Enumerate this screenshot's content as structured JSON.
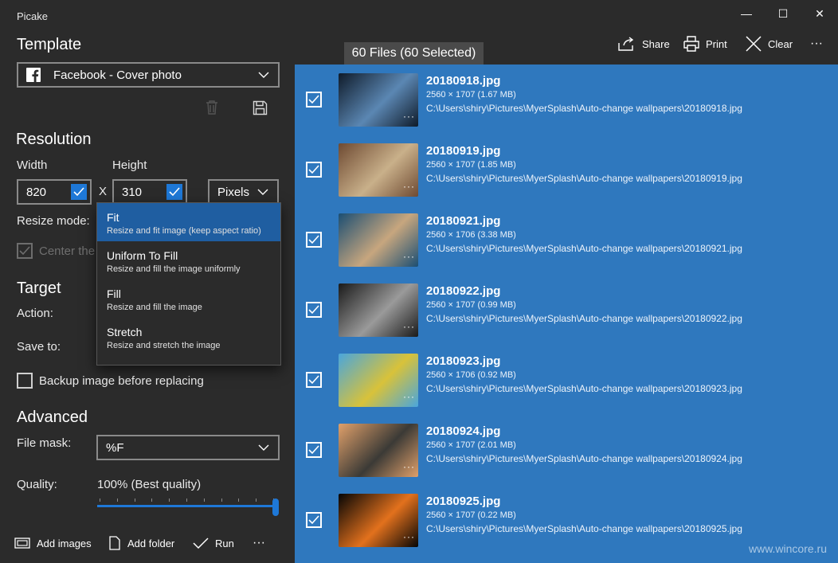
{
  "window": {
    "title": "Picake",
    "minimize_glyph": "—",
    "maximize_glyph": "☐",
    "close_glyph": "✕"
  },
  "template": {
    "heading": "Template",
    "selected": "Facebook - Cover photo",
    "icon": "facebook-icon"
  },
  "resolution": {
    "heading": "Resolution",
    "width_label": "Width",
    "height_label": "Height",
    "width_value": "820",
    "height_value": "310",
    "separator": "X",
    "unit": "Pixels",
    "resize_mode_label": "Resize mode:",
    "center_label": "Center the"
  },
  "resize_options": [
    {
      "title": "Fit",
      "desc": "Resize and fit image (keep aspect ratio)",
      "selected": true
    },
    {
      "title": "Uniform To Fill",
      "desc": "Resize and fill the image uniformly",
      "selected": false
    },
    {
      "title": "Fill",
      "desc": "Resize and fill the image",
      "selected": false
    },
    {
      "title": "Stretch",
      "desc": "Resize and stretch the image",
      "selected": false
    }
  ],
  "target": {
    "heading": "Target",
    "action_label": "Action:",
    "save_label": "Save to:",
    "backup_label": "Backup image before replacing"
  },
  "advanced": {
    "heading": "Advanced",
    "mask_label": "File mask:",
    "mask_value": "%F",
    "quality_label": "Quality:",
    "quality_value": "100% (Best quality)",
    "quality_fraction": 1.0
  },
  "bottom_toolbar": {
    "add_images": "Add images",
    "add_folder": "Add folder",
    "run": "Run",
    "more": "···"
  },
  "top_toolbar": {
    "share": "Share",
    "print": "Print",
    "clear": "Clear",
    "more": "···"
  },
  "files_header": "60 Files (60 Selected)",
  "files": [
    {
      "name": "20180918.jpg",
      "dims": "2560 × 1707 (1.67 MB)",
      "path": "C:\\Users\\shiry\\Pictures\\MyerSplash\\Auto-change wallpapers\\20180918.jpg",
      "colors": [
        "#0f1b2a",
        "#5b87b3"
      ]
    },
    {
      "name": "20180919.jpg",
      "dims": "2560 × 1707 (1.85 MB)",
      "path": "C:\\Users\\shiry\\Pictures\\MyerSplash\\Auto-change wallpapers\\20180919.jpg",
      "colors": [
        "#6e4a32",
        "#c9b08a"
      ]
    },
    {
      "name": "20180921.jpg",
      "dims": "2560 × 1706 (3.38 MB)",
      "path": "C:\\Users\\shiry\\Pictures\\MyerSplash\\Auto-change wallpapers\\20180921.jpg",
      "colors": [
        "#1b4e73",
        "#c7a67e"
      ]
    },
    {
      "name": "20180922.jpg",
      "dims": "2560 × 1707 (0.99 MB)",
      "path": "C:\\Users\\shiry\\Pictures\\MyerSplash\\Auto-change wallpapers\\20180922.jpg",
      "colors": [
        "#1a1a1a",
        "#9a9a9a"
      ]
    },
    {
      "name": "20180923.jpg",
      "dims": "2560 × 1706 (0.92 MB)",
      "path": "C:\\Users\\shiry\\Pictures\\MyerSplash\\Auto-change wallpapers\\20180923.jpg",
      "colors": [
        "#4aa6dc",
        "#d8c23a"
      ]
    },
    {
      "name": "20180924.jpg",
      "dims": "2560 × 1707 (2.01 MB)",
      "path": "C:\\Users\\shiry\\Pictures\\MyerSplash\\Auto-change wallpapers\\20180924.jpg",
      "colors": [
        "#e0a06a",
        "#3b3a36"
      ]
    },
    {
      "name": "20180925.jpg",
      "dims": "2560 × 1707 (0.22 MB)",
      "path": "C:\\Users\\shiry\\Pictures\\MyerSplash\\Auto-change wallpapers\\20180925.jpg",
      "colors": [
        "#050505",
        "#e2711d"
      ]
    }
  ],
  "thumb_more": "···",
  "watermark": "www.wincore.ru"
}
